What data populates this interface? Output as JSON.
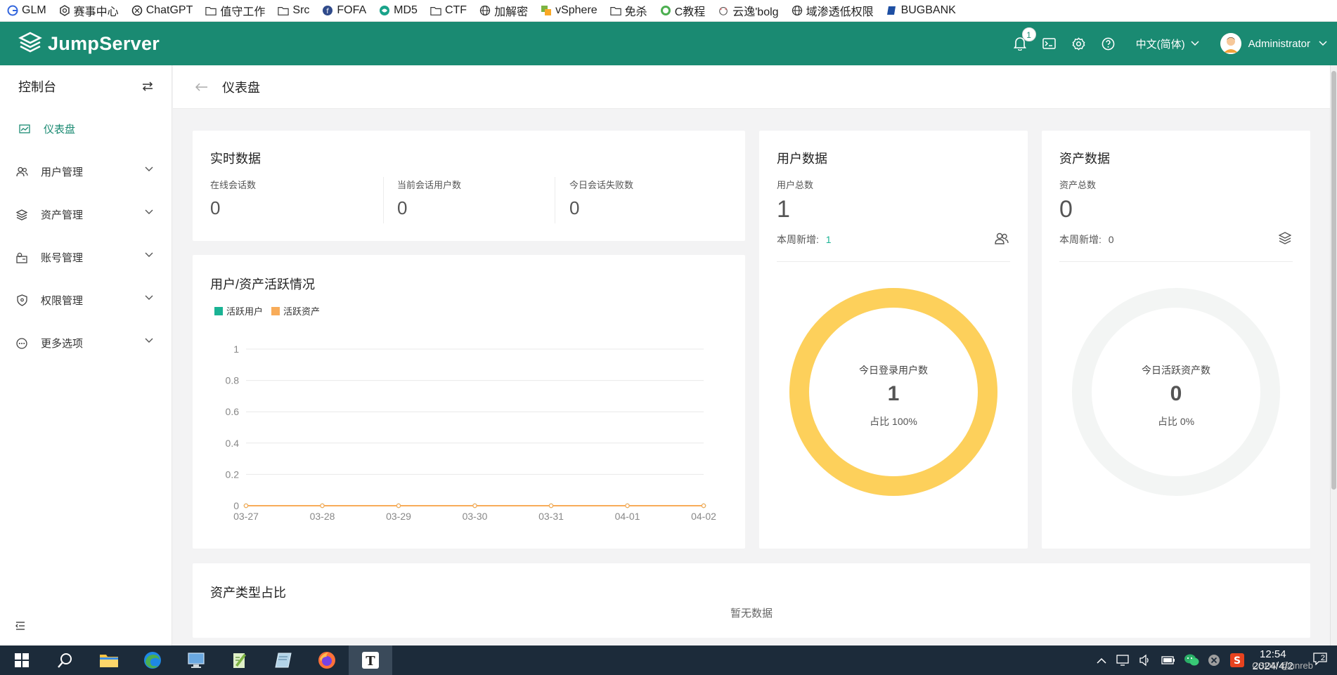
{
  "bookmarks": [
    {
      "label": "GLM",
      "icon": "glm-icon"
    },
    {
      "label": "赛事中心",
      "icon": "event-icon"
    },
    {
      "label": "ChatGPT",
      "icon": "chatgpt-icon"
    },
    {
      "label": "值守工作",
      "icon": "folder-icon"
    },
    {
      "label": "Src",
      "icon": "folder-icon"
    },
    {
      "label": "FOFA",
      "icon": "fofa-icon"
    },
    {
      "label": "MD5",
      "icon": "md5-icon"
    },
    {
      "label": "CTF",
      "icon": "folder-icon"
    },
    {
      "label": "加解密",
      "icon": "globe-icon"
    },
    {
      "label": "vSphere",
      "icon": "vsphere-icon"
    },
    {
      "label": "免杀",
      "icon": "folder-icon"
    },
    {
      "label": "C教程",
      "icon": "c-tutorial-icon"
    },
    {
      "label": "云逸'bolg",
      "icon": "blog-icon"
    },
    {
      "label": "域渗透低权限",
      "icon": "globe-icon"
    },
    {
      "label": "BUGBANK",
      "icon": "bugbank-icon"
    }
  ],
  "topnav": {
    "logo_text": "JumpServer",
    "notification_count": "1",
    "language": "中文(简体)",
    "username": "Administrator",
    "accent": "#1a8a72"
  },
  "sidebar": {
    "title": "控制台",
    "items": [
      {
        "label": "仪表盘",
        "icon": "dashboard-icon",
        "active": true
      },
      {
        "label": "用户管理",
        "icon": "users-icon"
      },
      {
        "label": "资产管理",
        "icon": "assets-icon"
      },
      {
        "label": "账号管理",
        "icon": "accounts-icon"
      },
      {
        "label": "权限管理",
        "icon": "shield-icon"
      },
      {
        "label": "更多选项",
        "icon": "more-icon"
      }
    ]
  },
  "breadcrumb": {
    "title": "仪表盘"
  },
  "realtime": {
    "title": "实时数据",
    "stats": [
      {
        "label": "在线会话数",
        "value": "0"
      },
      {
        "label": "当前会话用户数",
        "value": "0"
      },
      {
        "label": "今日会话失败数",
        "value": "0"
      }
    ]
  },
  "users_card": {
    "title": "用户数据",
    "total_label": "用户总数",
    "total_value": "1",
    "weekly_label": "本周新增:",
    "weekly_value": "1",
    "ring_label": "今日登录用户数",
    "ring_value": "1",
    "ring_pct": "占比 100%",
    "ring_fraction": 1.0,
    "ring_color": "#fdd05b"
  },
  "assets_card": {
    "title": "资产数据",
    "total_label": "资产总数",
    "total_value": "0",
    "weekly_label": "本周新增:",
    "weekly_value": "0",
    "ring_label": "今日活跃资产数",
    "ring_value": "0",
    "ring_pct": "占比 0%",
    "ring_fraction": 0.0,
    "ring_color": "#f3f5f4"
  },
  "activity": {
    "title": "用户/资产活跃情况"
  },
  "chart_data": {
    "type": "line",
    "x": [
      "03-27",
      "03-28",
      "03-29",
      "03-30",
      "03-31",
      "04-01",
      "04-02"
    ],
    "yticks": [
      "0",
      "0.2",
      "0.4",
      "0.6",
      "0.8",
      "1"
    ],
    "ylim": [
      0,
      1
    ],
    "grid": true,
    "legend_position": "top-left",
    "series": [
      {
        "name": "活跃用户",
        "values": [
          0,
          0,
          0,
          0,
          0,
          0,
          0
        ],
        "color": "#1ab394"
      },
      {
        "name": "活跃资产",
        "values": [
          0,
          0,
          0,
          0,
          0,
          0,
          0
        ],
        "color": "#f8ac59"
      }
    ]
  },
  "asset_types": {
    "title": "资产类型占比",
    "empty_text": "暂无数据"
  },
  "taskbar": {
    "time": "12:54",
    "date": "2024/4/2",
    "watermark": "CSDN @unreb",
    "notification_count": "2"
  }
}
